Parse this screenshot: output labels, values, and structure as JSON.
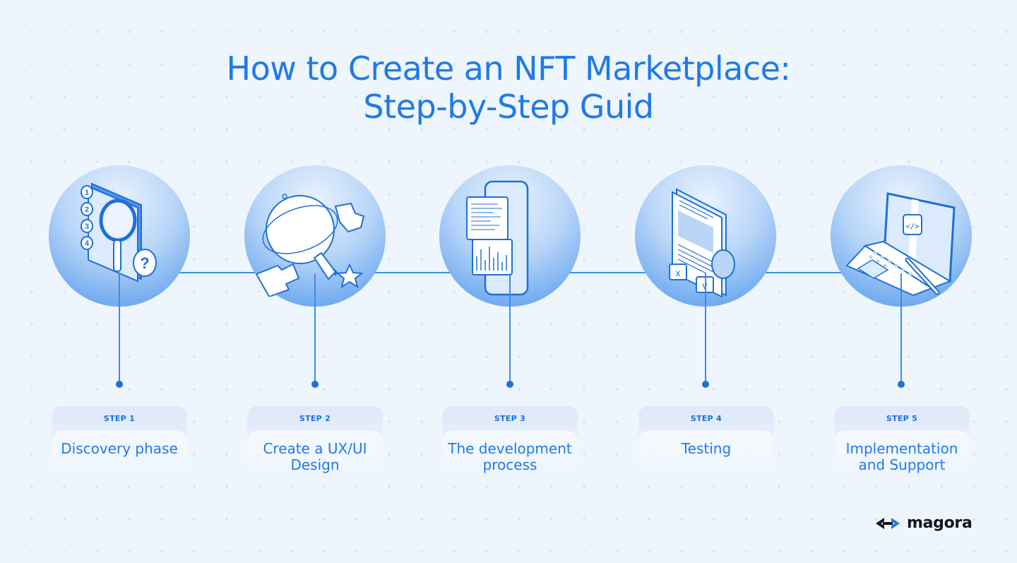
{
  "title": {
    "line1": "How to Create an NFT Marketplace:",
    "line2": "Step-by-Step Guid"
  },
  "colors": {
    "accent": "#1f7ae8",
    "line": "#3d8be6",
    "background": "#eef5fd",
    "logo_text": "#12161f"
  },
  "steps": [
    {
      "label": "STEP 1",
      "name": "Discovery phase",
      "icon": "document-magnifier-icon"
    },
    {
      "label": "STEP 2",
      "name": "Create a UX/UI Design",
      "icon": "lightbulb-puzzle-icon"
    },
    {
      "label": "STEP 3",
      "name": "The development process",
      "icon": "phone-code-window-icon"
    },
    {
      "label": "STEP 4",
      "name": "Testing",
      "icon": "document-checklist-icon"
    },
    {
      "label": "STEP 5",
      "name": "Implementation and Support",
      "icon": "laptop-wrench-icon"
    }
  ],
  "logo": {
    "text": "magora",
    "icon": "code-brackets-icon"
  }
}
